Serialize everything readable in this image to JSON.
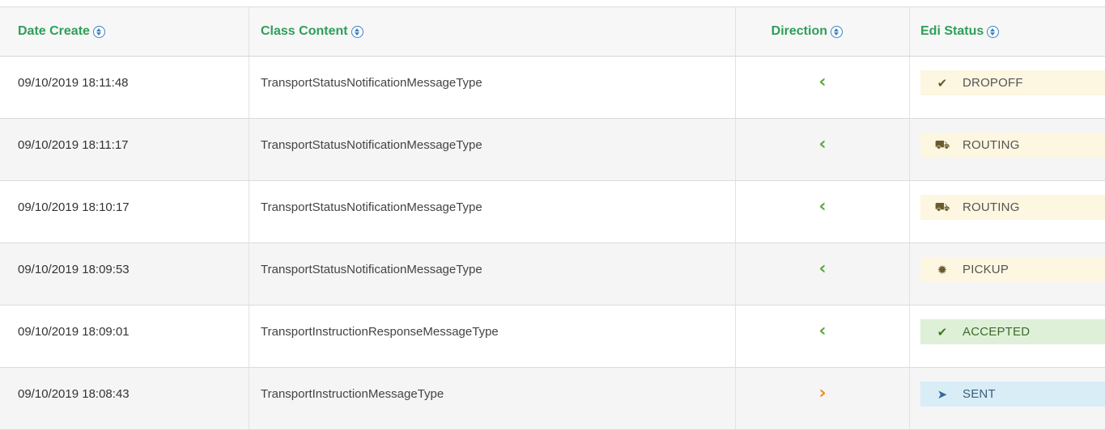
{
  "headers": {
    "date": "Date Create",
    "class": "Class Content",
    "direction": "Direction",
    "status": "Edi Status"
  },
  "rows": [
    {
      "date": "09/10/2019 18:11:48",
      "class": "TransportStatusNotificationMessageType",
      "direction": "‹",
      "direction_icon": "incoming-arrow-icon",
      "status": "DROPOFF",
      "status_icon": "✔",
      "status_icon_name": "check-icon",
      "status_color": "#fdf6e0"
    },
    {
      "date": "09/10/2019 18:11:17",
      "class": "TransportStatusNotificationMessageType",
      "direction": "‹",
      "direction_icon": "incoming-arrow-icon",
      "status": "ROUTING",
      "status_icon": "⛟",
      "status_icon_name": "truck-icon",
      "status_color": "#fdf6e0"
    },
    {
      "date": "09/10/2019 18:10:17",
      "class": "TransportStatusNotificationMessageType",
      "direction": "‹",
      "direction_icon": "incoming-arrow-icon",
      "status": "ROUTING",
      "status_icon": "⛟",
      "status_icon_name": "truck-icon",
      "status_color": "#fdf6e0"
    },
    {
      "date": "09/10/2019 18:09:53",
      "class": "TransportStatusNotificationMessageType",
      "direction": "‹",
      "direction_icon": "incoming-arrow-icon",
      "status": "PICKUP",
      "status_icon": "✹",
      "status_icon_name": "gear-icon",
      "status_color": "#fdf6e0"
    },
    {
      "date": "09/10/2019 18:09:01",
      "class": "TransportInstructionResponseMessageType",
      "direction": "‹",
      "direction_icon": "incoming-arrow-icon",
      "status": "ACCEPTED",
      "status_icon": "✔",
      "status_icon_name": "check-icon",
      "status_color": "#dff0d8"
    },
    {
      "date": "09/10/2019 18:08:43",
      "class": "TransportInstructionMessageType",
      "direction": "›",
      "direction_icon": "outgoing-arrow-icon",
      "status": "SENT",
      "status_icon": "➤",
      "status_icon_name": "send-icon",
      "status_color": "#d9edf7"
    }
  ],
  "colors": {
    "header_text": "#2f9e5a",
    "incoming": "#5aa83a",
    "outgoing": "#f28a1e"
  }
}
